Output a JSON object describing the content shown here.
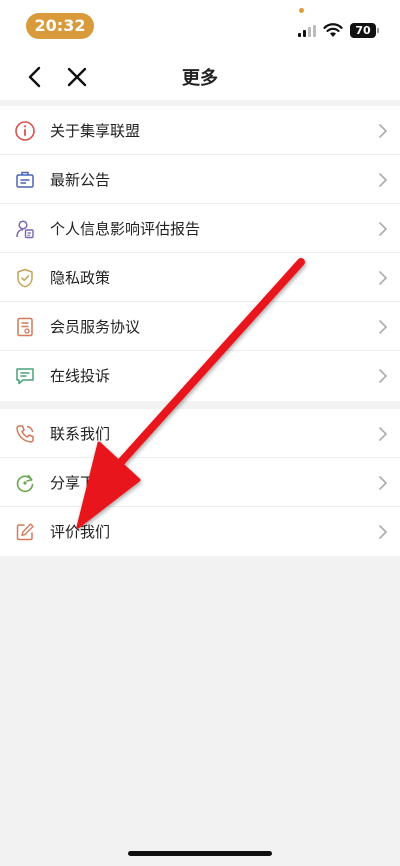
{
  "status_bar": {
    "time": "20:32",
    "battery": "70"
  },
  "nav": {
    "title": "更多"
  },
  "menu_group_1": [
    {
      "label": "关于集享联盟",
      "icon": "info-circle-icon"
    },
    {
      "label": "最新公告",
      "icon": "announcement-icon"
    },
    {
      "label": "个人信息影响评估报告",
      "icon": "person-report-icon"
    },
    {
      "label": "隐私政策",
      "icon": "shield-check-icon"
    },
    {
      "label": "会员服务协议",
      "icon": "document-icon"
    },
    {
      "label": "在线投诉",
      "icon": "chat-icon"
    }
  ],
  "menu_group_2": [
    {
      "label": "联系我们",
      "icon": "phone-icon"
    },
    {
      "label": "分享下载",
      "icon": "share-refresh-icon"
    },
    {
      "label": "评价我们",
      "icon": "edit-pencil-icon"
    }
  ],
  "colors": {
    "accent": "#d89a3b",
    "annotation_arrow": "#e8161b",
    "page_background": "#f2f2f2"
  }
}
